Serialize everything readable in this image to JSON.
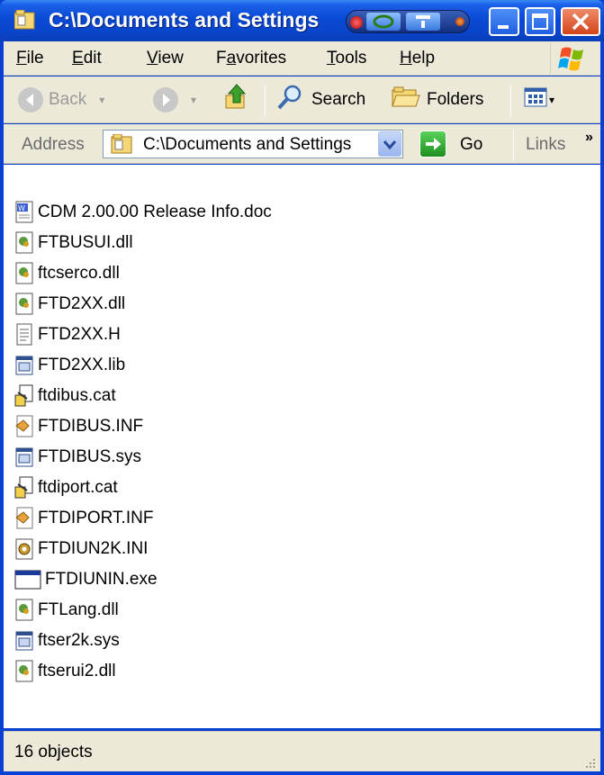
{
  "window": {
    "title": "C:\\Documents and Settings"
  },
  "menubar": {
    "items": [
      {
        "label": "File",
        "accel": "F"
      },
      {
        "label": "Edit",
        "accel": "E"
      },
      {
        "label": "View",
        "accel": "V"
      },
      {
        "label": "Favorites",
        "accel": "a"
      },
      {
        "label": "Tools",
        "accel": "T"
      },
      {
        "label": "Help",
        "accel": "H"
      }
    ]
  },
  "toolbar": {
    "back_label": "Back",
    "search_label": "Search",
    "folders_label": "Folders"
  },
  "addressbar": {
    "label": "Address",
    "value": "C:\\Documents and Settings",
    "go_label": "Go",
    "links_label": "Links"
  },
  "files": [
    {
      "name": "CDM 2.00.00 Release Info.doc",
      "icon": "word-document-icon"
    },
    {
      "name": "FTBUSUI.dll",
      "icon": "dll-file-icon"
    },
    {
      "name": "ftcserco.dll",
      "icon": "dll-file-icon"
    },
    {
      "name": "FTD2XX.dll",
      "icon": "dll-file-icon"
    },
    {
      "name": "FTD2XX.H",
      "icon": "text-file-icon"
    },
    {
      "name": "FTD2XX.lib",
      "icon": "system-file-icon"
    },
    {
      "name": "ftdibus.cat",
      "icon": "security-catalog-icon"
    },
    {
      "name": "FTDIBUS.INF",
      "icon": "setup-information-icon"
    },
    {
      "name": "FTDIBUS.sys",
      "icon": "system-file-icon"
    },
    {
      "name": "ftdiport.cat",
      "icon": "security-catalog-icon"
    },
    {
      "name": "FTDIPORT.INF",
      "icon": "setup-information-icon"
    },
    {
      "name": "FTDIUN2K.INI",
      "icon": "config-settings-icon"
    },
    {
      "name": "FTDIUNIN.exe",
      "icon": "application-window-icon"
    },
    {
      "name": "FTLang.dll",
      "icon": "dll-file-icon"
    },
    {
      "name": "ftser2k.sys",
      "icon": "system-file-icon"
    },
    {
      "name": "ftserui2.dll",
      "icon": "dll-file-icon"
    }
  ],
  "statusbar": {
    "text": "16 objects"
  },
  "colors": {
    "titlebar": "#0a4ad6",
    "chrome": "#ece9d8",
    "border": "#0a3fd4"
  }
}
